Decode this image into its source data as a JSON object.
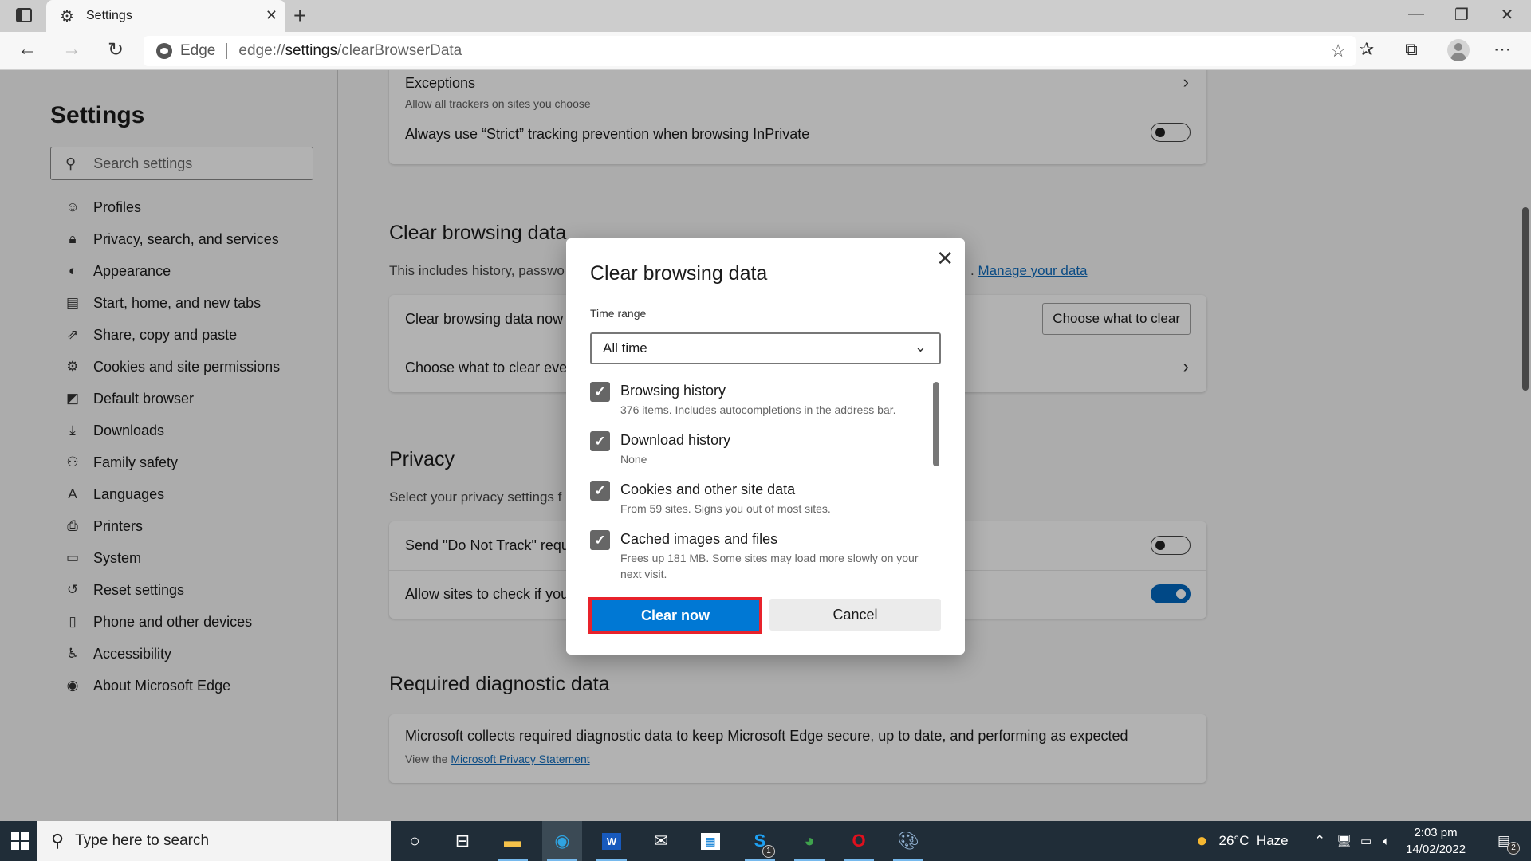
{
  "browser": {
    "tab_title": "Settings",
    "address_brand": "Edge",
    "url_prefix": "edge://",
    "url_bold": "settings",
    "url_suffix": "/clearBrowserData",
    "icons": {
      "tab_actions": "tab-actions-icon",
      "tab": "gear-icon",
      "close_tab": "close-icon",
      "new_tab": "plus-icon",
      "back": "arrow-left-icon",
      "forward": "arrow-right-icon",
      "refresh": "refresh-icon",
      "add_favorite": "star-plus-icon",
      "favorites": "favorites-icon",
      "collections": "collections-icon",
      "profile": "avatar-icon",
      "more": "ellipsis-icon",
      "minimize": "minimize-icon",
      "restore": "restore-icon",
      "close": "close-icon"
    }
  },
  "sidebar": {
    "title": "Settings",
    "search_placeholder": "Search settings",
    "items": [
      {
        "label": "Profiles",
        "icon": "profile-icon",
        "glyph": "☺"
      },
      {
        "label": "Privacy, search, and services",
        "icon": "lock-icon",
        "glyph": "🔒︎"
      },
      {
        "label": "Appearance",
        "icon": "palette-icon",
        "glyph": "◐"
      },
      {
        "label": "Start, home, and new tabs",
        "icon": "new-tab-icon",
        "glyph": "▤"
      },
      {
        "label": "Share, copy and paste",
        "icon": "share-icon",
        "glyph": "⇗"
      },
      {
        "label": "Cookies and site permissions",
        "icon": "cookies-permissions-icon",
        "glyph": "⚙"
      },
      {
        "label": "Default browser",
        "icon": "default-browser-icon",
        "glyph": "◩"
      },
      {
        "label": "Downloads",
        "icon": "download-icon",
        "glyph": "⤓"
      },
      {
        "label": "Family safety",
        "icon": "family-icon",
        "glyph": "⚇"
      },
      {
        "label": "Languages",
        "icon": "languages-icon",
        "glyph": "A"
      },
      {
        "label": "Printers",
        "icon": "printer-icon",
        "glyph": "⎙"
      },
      {
        "label": "System",
        "icon": "laptop-icon",
        "glyph": "▭"
      },
      {
        "label": "Reset settings",
        "icon": "reset-icon",
        "glyph": "↺"
      },
      {
        "label": "Phone and other devices",
        "icon": "phone-icon",
        "glyph": "▯"
      },
      {
        "label": "Accessibility",
        "icon": "accessibility-icon",
        "glyph": "♿︎"
      },
      {
        "label": "About Microsoft Edge",
        "icon": "edge-logo-icon",
        "glyph": "◉"
      }
    ]
  },
  "main": {
    "tracking": {
      "exceptions_title": "Exceptions",
      "exceptions_desc": "Allow all trackers on sites you choose",
      "strict_label": "Always use “Strict” tracking prevention when browsing InPrivate",
      "strict_on": false
    },
    "clear_section": {
      "title": "Clear browsing data",
      "desc_visible": "This includes history, passwo",
      "manage_link_prefix": ".",
      "manage_link": "Manage your data",
      "row1_label": "Clear browsing data now",
      "row1_button": "Choose what to clear",
      "row2_label": "Choose what to clear ever"
    },
    "privacy_section": {
      "title": "Privacy",
      "desc_visible": "Select your privacy settings f",
      "dnt_label": "Send \"Do Not Track\" requ",
      "dnt_on": false,
      "payment_label": "Allow sites to check if you",
      "payment_on": true
    },
    "diagnostic_section": {
      "title": "Required diagnostic data",
      "text": "Microsoft collects required diagnostic data to keep Microsoft Edge secure, up to date, and performing as expected",
      "view_prefix": "View the",
      "link": "Microsoft Privacy Statement"
    }
  },
  "dialog": {
    "title": "Clear browsing data",
    "time_range_label": "Time range",
    "time_range_value": "All time",
    "options": [
      {
        "label": "Browsing history",
        "hint": "376 items. Includes autocompletions in the address bar.",
        "checked": true
      },
      {
        "label": "Download history",
        "hint": "None",
        "checked": true
      },
      {
        "label": "Cookies and other site data",
        "hint": "From 59 sites. Signs you out of most sites.",
        "checked": true
      },
      {
        "label": "Cached images and files",
        "hint": "Frees up 181 MB. Some sites may load more slowly on your next visit.",
        "checked": true
      }
    ],
    "clear_button": "Clear now",
    "cancel_button": "Cancel",
    "highlight_color": "#e8222b",
    "accent_color": "#0078d4"
  },
  "taskbar": {
    "search_placeholder": "Type here to search",
    "apps": [
      {
        "name": "cortana",
        "icon": "cortana-icon"
      },
      {
        "name": "task-view",
        "icon": "task-view-icon"
      },
      {
        "name": "file-explorer",
        "icon": "folder-icon"
      },
      {
        "name": "edge",
        "icon": "edge-icon"
      },
      {
        "name": "word",
        "icon": "word-icon"
      },
      {
        "name": "mail",
        "icon": "mail-icon"
      },
      {
        "name": "store",
        "icon": "store-icon"
      },
      {
        "name": "skype",
        "icon": "skype-icon",
        "badge": "1"
      },
      {
        "name": "chrome",
        "icon": "chrome-icon"
      },
      {
        "name": "opera",
        "icon": "opera-icon"
      },
      {
        "name": "paint",
        "icon": "paint-icon"
      }
    ],
    "weather": "26°C  Haze",
    "time": "2:03 pm",
    "date": "14/02/2022",
    "notifications_badge": "2"
  }
}
